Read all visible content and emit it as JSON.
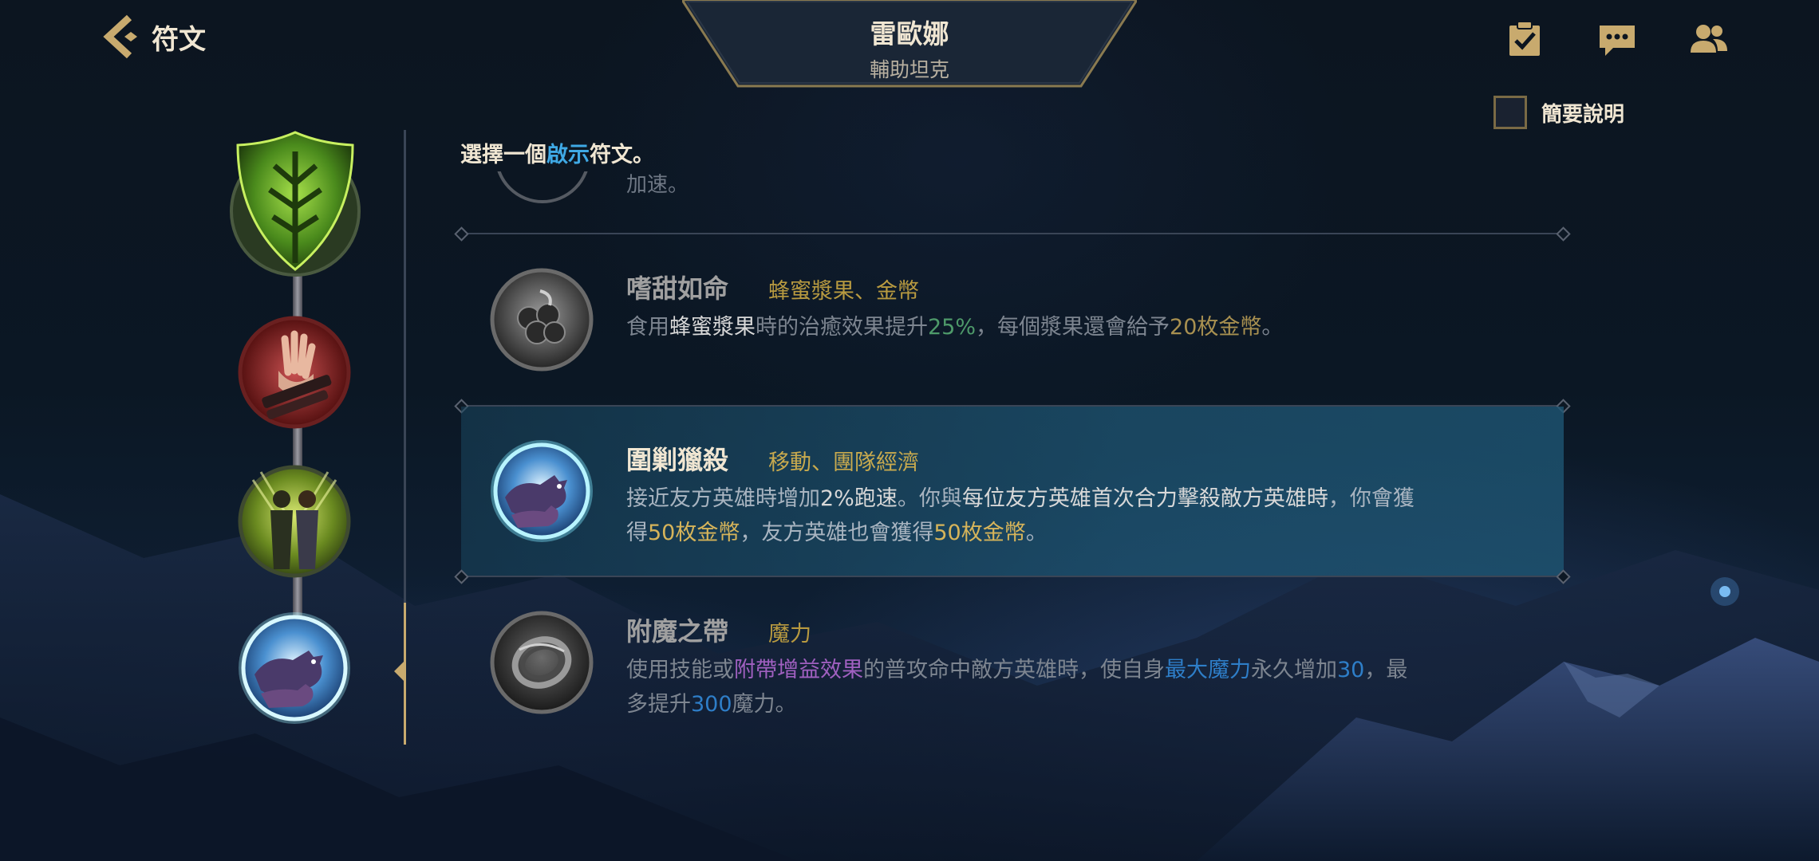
{
  "header": {
    "back_label": "符文",
    "champion_name": "雷歐娜",
    "champion_role": "輔助坦克"
  },
  "toolbar": {
    "icons": [
      "checklist-icon",
      "chat-icon",
      "friends-icon"
    ]
  },
  "brief_toggle": {
    "label": "簡要說明",
    "checked": false
  },
  "prompt": {
    "prefix": "選擇一個",
    "highlight": "啟示",
    "suffix": "符文。"
  },
  "previous_row_fragment": "加速。",
  "runes": [
    {
      "title": "嗜甜如命",
      "tags": "蜂蜜漿果、金幣",
      "desc": [
        {
          "t": "食用",
          "c": ""
        },
        {
          "t": "蜂蜜漿果",
          "c": "hl-white"
        },
        {
          "t": "時的治癒效果提升",
          "c": ""
        },
        {
          "t": "25%",
          "c": "hl-green"
        },
        {
          "t": "，每個漿果還會給予",
          "c": ""
        },
        {
          "t": "20枚金幣",
          "c": "hl-gold"
        },
        {
          "t": "。",
          "c": ""
        }
      ],
      "selected": false
    },
    {
      "title": "圍剿獵殺",
      "tags": "移動、團隊經濟",
      "desc": [
        {
          "t": "接近友方英雄時增加",
          "c": ""
        },
        {
          "t": "2%跑速",
          "c": "hl-white"
        },
        {
          "t": "。你與",
          "c": ""
        },
        {
          "t": "每位友方英雄首次合力擊殺敵方英雄時",
          "c": "hl-white"
        },
        {
          "t": "，你會獲得",
          "c": ""
        },
        {
          "t": "50枚金幣",
          "c": "hl-gold-bright"
        },
        {
          "t": "，友方英雄也會獲得",
          "c": ""
        },
        {
          "t": "50枚金幣",
          "c": "hl-gold-bright"
        },
        {
          "t": "。",
          "c": ""
        }
      ],
      "selected": true
    },
    {
      "title": "附魔之帶",
      "tags": "魔力",
      "desc": [
        {
          "t": "使用技能或",
          "c": ""
        },
        {
          "t": "附帶增益效果",
          "c": "hl-purple"
        },
        {
          "t": "的普攻命中敵方英雄時，使自身",
          "c": ""
        },
        {
          "t": "最大魔力",
          "c": "hl-blue"
        },
        {
          "t": "永久增加",
          "c": ""
        },
        {
          "t": "30",
          "c": "hl-blue"
        },
        {
          "t": "，最多提升",
          "c": ""
        },
        {
          "t": "300",
          "c": "hl-blue"
        },
        {
          "t": "魔力。",
          "c": ""
        }
      ],
      "selected": false
    }
  ],
  "tree": {
    "nodes": [
      "resolve-tree-emblem-icon",
      "aftershock-rune-icon",
      "bond-rune-icon",
      "hunt-rune-icon"
    ],
    "active_index": 3
  },
  "colors": {
    "gold": "#c8aa6e",
    "accent_blue": "#3fa9e5",
    "selected_row": "#1e5573"
  }
}
